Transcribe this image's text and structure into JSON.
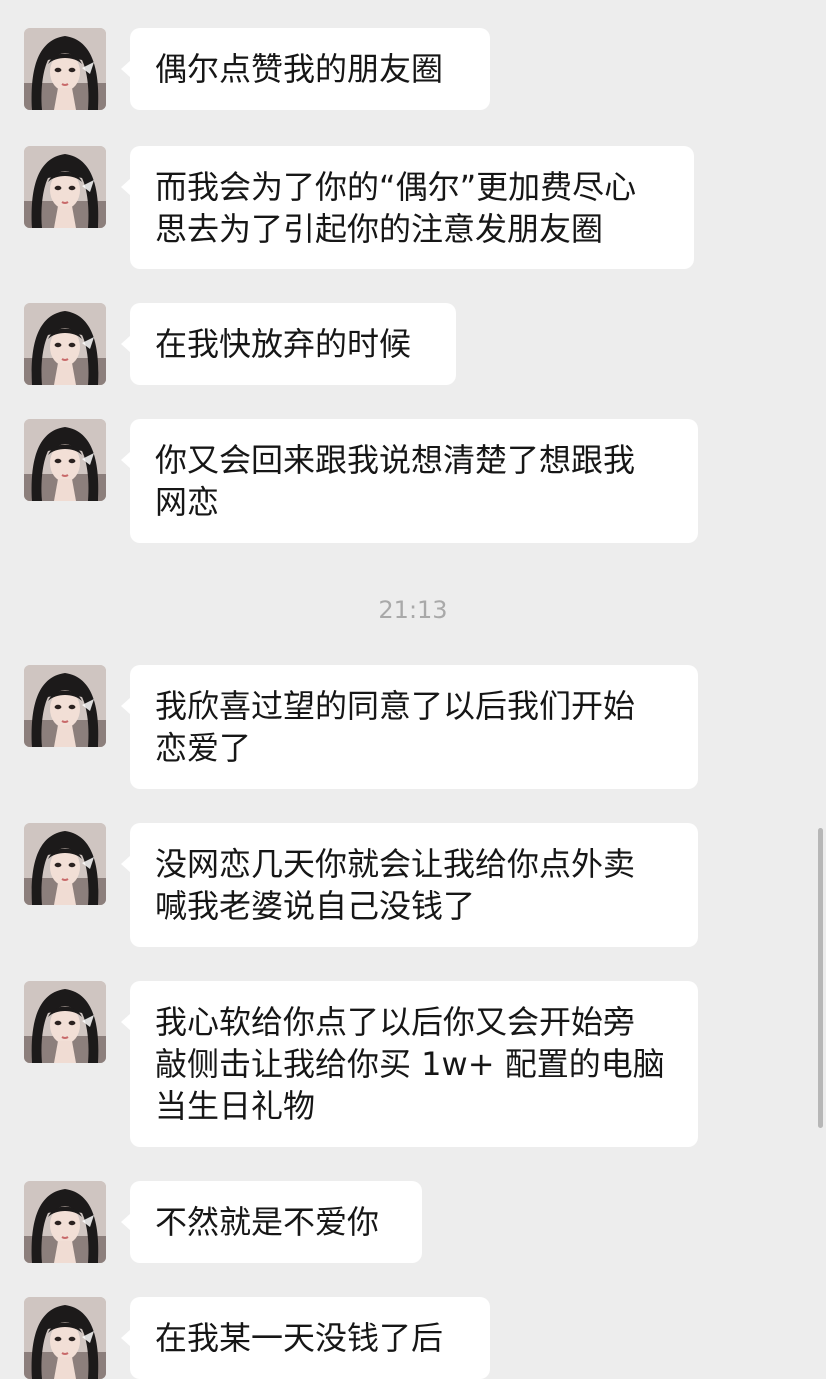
{
  "messages": [
    {
      "text": "偶尔点赞我的朋友圈",
      "avatar_icon": "girl-selfie-avatar"
    },
    {
      "text": "而我会为了你的“偶尔”更加费尽心\n思去为了引起你的注意发朋友圈",
      "avatar_icon": "girl-selfie-avatar"
    },
    {
      "text": "在我快放弃的时候",
      "avatar_icon": "girl-selfie-avatar"
    },
    {
      "text": "你又会回来跟我说想清楚了想跟我\n网恋",
      "avatar_icon": "girl-selfie-avatar"
    },
    {
      "text": "我欣喜过望的同意了以后我们开始\n恋爱了",
      "avatar_icon": "girl-selfie-avatar"
    },
    {
      "text": "没网恋几天你就会让我给你点外卖\n喊我老婆说自己没钱了",
      "avatar_icon": "girl-selfie-avatar"
    },
    {
      "text": "我心软给你点了以后你又会开始旁\n敲侧击让我给你买 1w+ 配置的电脑\n当生日礼物",
      "avatar_icon": "girl-selfie-avatar"
    },
    {
      "text": "不然就是不爱你",
      "avatar_icon": "girl-selfie-avatar"
    },
    {
      "text": "在我某一天没钱了后",
      "avatar_icon": "girl-selfie-avatar"
    }
  ],
  "timestamp": "21:13",
  "colors": {
    "background": "#ededed",
    "bubble": "#ffffff",
    "text": "#161616",
    "timestamp": "#a9a9a9"
  }
}
